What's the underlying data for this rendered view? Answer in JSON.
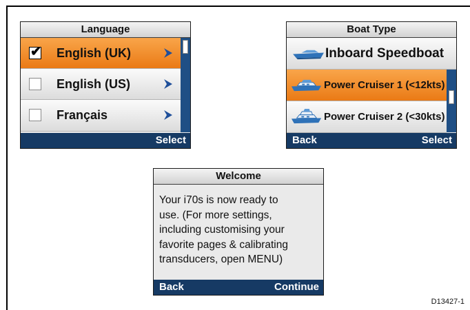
{
  "language_screen": {
    "title": "Language",
    "items": [
      {
        "label": "English (UK)",
        "checked": true,
        "selected": true
      },
      {
        "label": "English (US)",
        "checked": false,
        "selected": false
      },
      {
        "label": "Français",
        "checked": false,
        "selected": false
      }
    ],
    "softkeys": {
      "left": "",
      "right": "Select"
    }
  },
  "boat_type_screen": {
    "title": "Boat Type",
    "items": [
      {
        "label": "Inboard Speedboat",
        "icon": "speedboat-icon",
        "selected": false
      },
      {
        "label": "Power Cruiser 1 (<12kts)",
        "icon": "power-cruiser-icon",
        "selected": true
      },
      {
        "label": "Power Cruiser 2 (<30kts)",
        "icon": "power-cruiser-icon",
        "selected": false
      }
    ],
    "softkeys": {
      "left": "Back",
      "right": "Select"
    }
  },
  "welcome_screen": {
    "title": "Welcome",
    "lines": [
      "Your i70s is now ready to",
      "use. (For more settings,",
      "including customising your",
      "favorite pages & calibrating",
      "transducers, open MENU)"
    ],
    "softkeys": {
      "left": "Back",
      "right": "Continue"
    }
  },
  "document_ref": "D13427-1",
  "colors": {
    "highlight": "#F08A24",
    "softbar": "#163A64",
    "chevron": "#1F4F9A",
    "boat": "#2F72B8"
  }
}
